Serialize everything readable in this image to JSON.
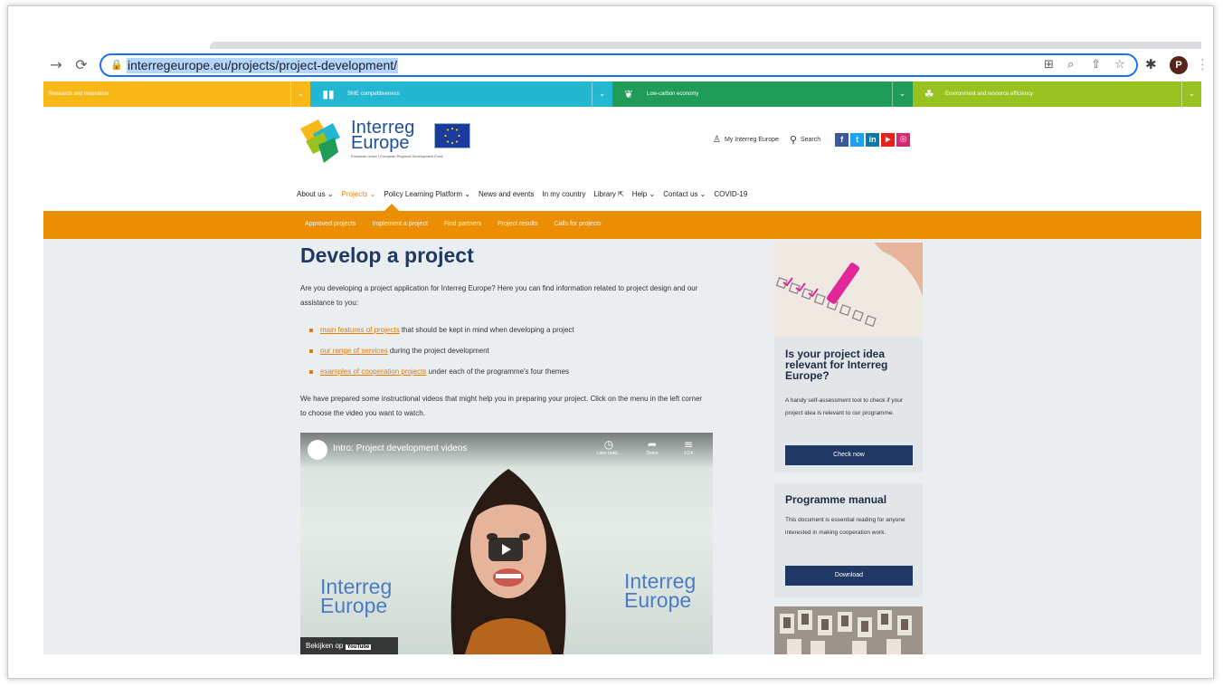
{
  "browser": {
    "url": "interregeurope.eu/projects/project-development/",
    "profile_initial": "P"
  },
  "themes": [
    {
      "label": "Research and innovation",
      "color": "#f7b818"
    },
    {
      "label": "SME competitiveness",
      "color": "#23b7d1"
    },
    {
      "label": "Low-carbon economy",
      "color": "#1f9c57"
    },
    {
      "label": "Environment and resource efficiency",
      "color": "#97c21f"
    }
  ],
  "logo": {
    "line1": "Interreg",
    "line2": "Europe",
    "subtitle": "European Union | European Regional Development Fund"
  },
  "header": {
    "my_interreg": "My Interreg Europe",
    "search": "Search",
    "social": [
      {
        "name": "facebook",
        "glyph": "f",
        "color": "#3b5998"
      },
      {
        "name": "twitter",
        "glyph": "t",
        "color": "#1da1f2"
      },
      {
        "name": "linkedin",
        "glyph": "in",
        "color": "#0e76a8"
      },
      {
        "name": "youtube",
        "glyph": "▶",
        "color": "#e62117"
      },
      {
        "name": "instagram",
        "glyph": "◎",
        "color": "#d62976"
      }
    ]
  },
  "nav": {
    "items": [
      {
        "label": "About us",
        "dropdown": true
      },
      {
        "label": "Projects",
        "dropdown": true,
        "active": true
      },
      {
        "label": "Policy Learning Platform",
        "dropdown": true
      },
      {
        "label": "News and events",
        "dropdown": false
      },
      {
        "label": "In my country",
        "dropdown": false
      },
      {
        "label": "Library",
        "dropdown": false
      },
      {
        "label": "Help",
        "dropdown": true
      },
      {
        "label": "Contact us",
        "dropdown": true
      },
      {
        "label": "COVID-19",
        "dropdown": false
      }
    ],
    "subitems": [
      "Approved projects",
      "Implement a project",
      "Find partners",
      "Project results",
      "Calls for projects"
    ]
  },
  "main": {
    "title": "Develop a project",
    "intro": "Are you developing a project application for Interreg Europe? Here you can find information related to project design and our assistance to you:",
    "bullets": [
      {
        "link": "main features of projects",
        "rest": " that should be kept in mind when developing a project"
      },
      {
        "link": "our range of services",
        "rest": " during the project development"
      },
      {
        "link": "examples of cooperation projects",
        "rest": " under each of the programme's four themes"
      }
    ],
    "videos_text": "We have prepared some instructional videos that might help you in preparing your project. Click on the menu in the left corner to choose the video you want to watch."
  },
  "video": {
    "title": "Intro: Project development videos",
    "later": "Later bekij...",
    "share": "Delen",
    "playlist": "1/14",
    "watch_on": "Bekijken op",
    "youtube": "YouTube",
    "logo_line1": "Interreg",
    "logo_line2": "Europe"
  },
  "sidebar": {
    "card1": {
      "title": "Is your project idea relevant for Interreg Europe?",
      "text": "A handy self-assessment tool to check if your project idea is relevant to our programme.",
      "button": "Check now"
    },
    "card2": {
      "title": "Programme manual",
      "text": "This document is essential reading for anyone interested in making cooperation work.",
      "button": "Download"
    }
  }
}
